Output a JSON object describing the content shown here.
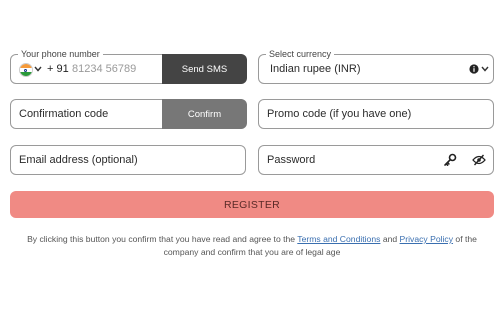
{
  "phone": {
    "legend": "Your phone number",
    "country_code": "+ 91",
    "placeholder": "81234 56789",
    "send_sms_label": "Send SMS",
    "flag_icon": "india-flag-icon"
  },
  "currency": {
    "legend": "Select currency",
    "value": "Indian rupee (INR)"
  },
  "confirmation": {
    "placeholder": "Confirmation code",
    "confirm_label": "Confirm"
  },
  "promo": {
    "placeholder": "Promo code (if you have one)"
  },
  "email": {
    "placeholder": "Email address (optional)"
  },
  "password": {
    "placeholder": "Password"
  },
  "register": {
    "label": "REGISTER",
    "color": "#f08a84"
  },
  "terms": {
    "prefix": "By clicking this button you confirm that you have read and agree to the",
    "terms_link": "Terms and Conditions",
    "and": "and",
    "privacy_link": "Privacy Policy",
    "suffix": "of the company and confirm that you are of legal age"
  }
}
